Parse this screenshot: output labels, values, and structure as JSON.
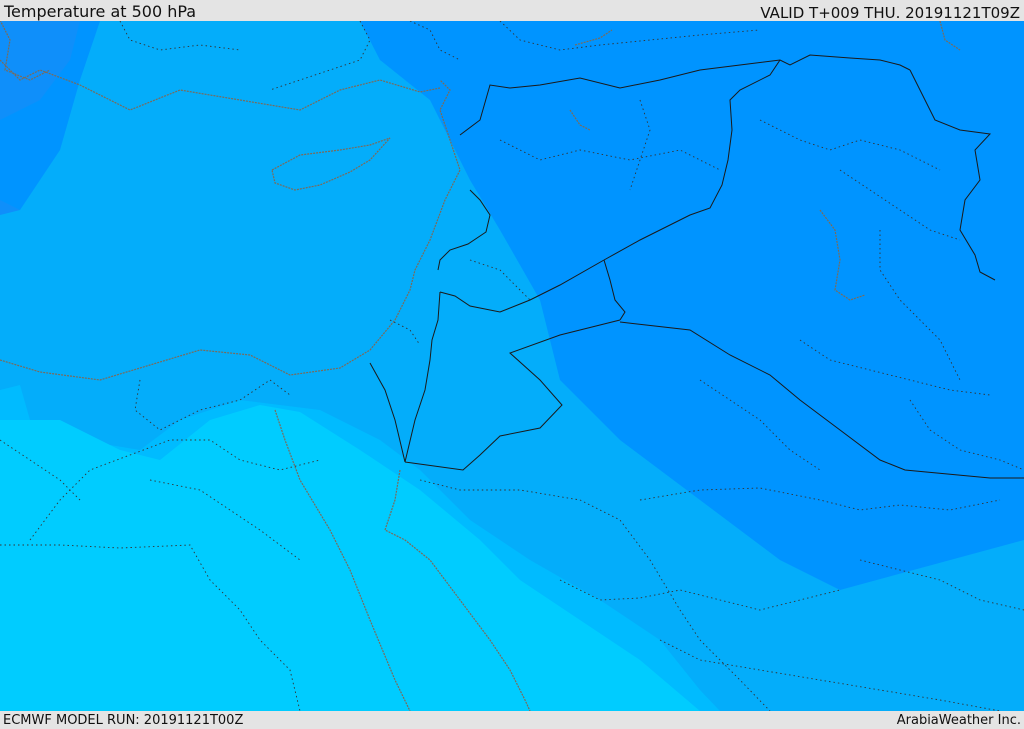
{
  "header": {
    "title": "Temperature at 500 hPa",
    "valid": "VALID T+009 THU. 20191121T09Z"
  },
  "footer": {
    "model_run": "ECMWF MODEL RUN: 20191121T00Z",
    "brand": "ArabiaWeather Inc."
  },
  "map": {
    "field": "Temperature at 500 hPa",
    "colors": {
      "band_coldest": "#0f8ffa",
      "band_cold": "#0094ff",
      "band_mid": "#04adfa",
      "band_warm": "#00bbff",
      "band_warmest": "#00ccff",
      "country_border": "#1a1a1a",
      "coastline": "#7a6b5b",
      "admin_border": "#333333"
    }
  }
}
